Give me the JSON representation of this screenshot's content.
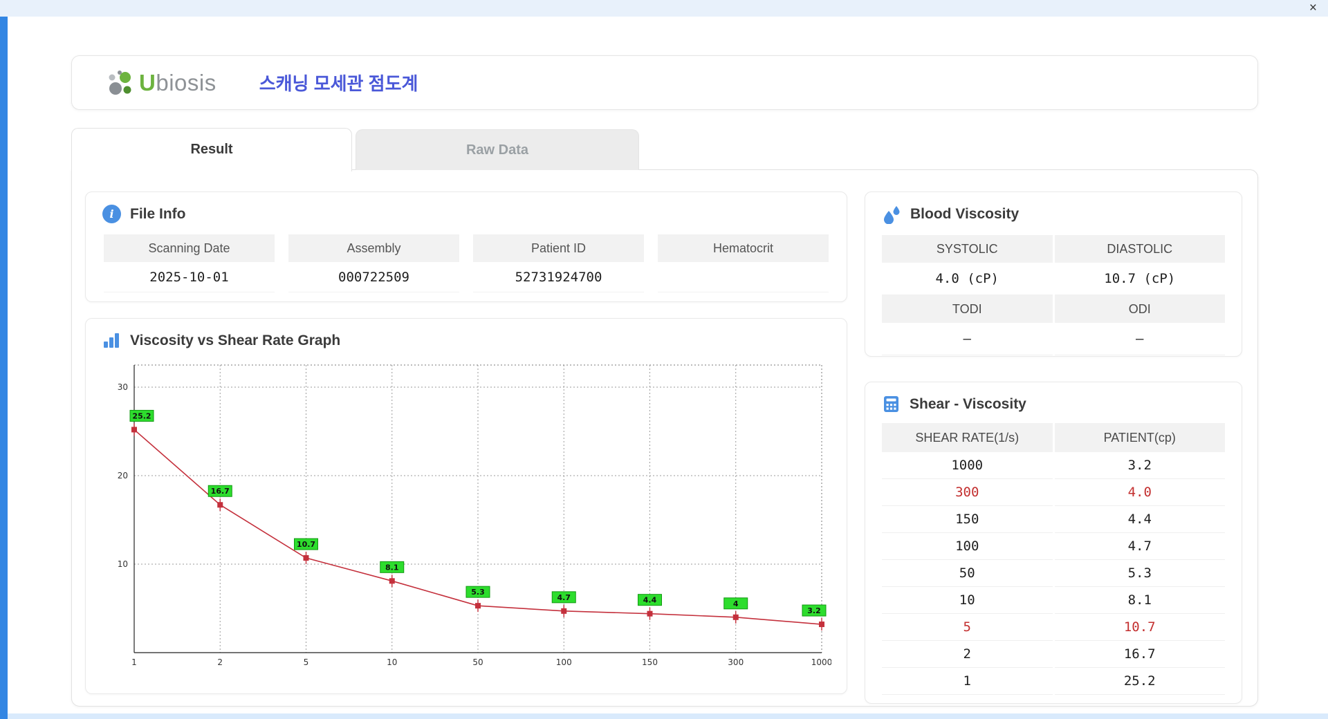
{
  "window": {
    "close_icon": "×"
  },
  "header": {
    "logo_u": "U",
    "logo_rest": "biosis",
    "title": "스캐닝 모세관 점도계"
  },
  "tabs": {
    "result": "Result",
    "raw_data": "Raw Data"
  },
  "file_info": {
    "title": "File Info",
    "fields": [
      {
        "label": "Scanning Date",
        "value": "2025-10-01"
      },
      {
        "label": "Assembly",
        "value": "000722509"
      },
      {
        "label": "Patient ID",
        "value": "52731924700"
      },
      {
        "label": "Hematocrit",
        "value": ""
      }
    ]
  },
  "blood_viscosity": {
    "title": "Blood Viscosity",
    "row1": {
      "headers": [
        "SYSTOLIC",
        "DIASTOLIC"
      ],
      "values": [
        "4.0 (cP)",
        "10.7 (cP)"
      ]
    },
    "row2": {
      "headers": [
        "TODI",
        "ODI"
      ],
      "values": [
        "–",
        "–"
      ]
    }
  },
  "graph": {
    "title": "Viscosity vs Shear Rate Graph"
  },
  "chart_data": {
    "type": "line",
    "title": "Viscosity vs Shear Rate Graph",
    "x": [
      1,
      2,
      5,
      10,
      50,
      100,
      150,
      300,
      1000
    ],
    "values": [
      25.2,
      16.7,
      10.7,
      8.1,
      5.3,
      4.7,
      4.4,
      4.0,
      3.2
    ],
    "labels": [
      "25.2",
      "16.7",
      "10.7",
      "8.1",
      "5.3",
      "4.7",
      "4.4",
      "4",
      "3.2"
    ],
    "x_scale": "categorical",
    "xlabel": "",
    "ylabel": "",
    "ylim": [
      0,
      32.5
    ],
    "yticks": [
      10,
      20,
      30
    ],
    "grid": "dotted",
    "line_color": "#c4303c",
    "marker_color": "#c4303c",
    "label_bg": "#2ddd2d",
    "label_border": "#119911",
    "legend": "none"
  },
  "shear_table": {
    "title": "Shear - Viscosity",
    "headers": [
      "SHEAR RATE(1/s)",
      "PATIENT(cp)"
    ],
    "rows": [
      {
        "shear": "1000",
        "patient": "3.2",
        "highlight": false
      },
      {
        "shear": "300",
        "patient": "4.0",
        "highlight": true
      },
      {
        "shear": "150",
        "patient": "4.4",
        "highlight": false
      },
      {
        "shear": "100",
        "patient": "4.7",
        "highlight": false
      },
      {
        "shear": "50",
        "patient": "5.3",
        "highlight": false
      },
      {
        "shear": "10",
        "patient": "8.1",
        "highlight": false
      },
      {
        "shear": "5",
        "patient": "10.7",
        "highlight": true
      },
      {
        "shear": "2",
        "patient": "16.7",
        "highlight": false
      },
      {
        "shear": "1",
        "patient": "25.2",
        "highlight": false
      }
    ],
    "highlight_color": "#c32f2f"
  }
}
